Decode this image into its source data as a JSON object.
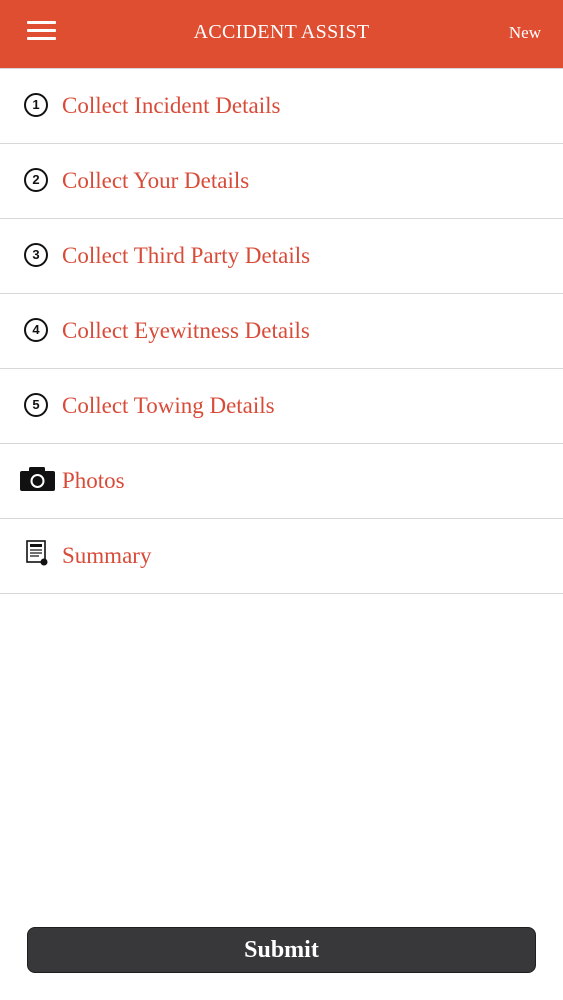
{
  "header": {
    "title": "ACCIDENT ASSIST",
    "action_label": "New",
    "menu_icon": "hamburger-menu-icon",
    "background_color": "#e04e32"
  },
  "list": {
    "items": [
      {
        "icon": "number-1-icon",
        "badge": "1",
        "label": "Collect Incident Details"
      },
      {
        "icon": "number-2-icon",
        "badge": "2",
        "label": "Collect Your Details"
      },
      {
        "icon": "number-3-icon",
        "badge": "3",
        "label": "Collect Third Party Details"
      },
      {
        "icon": "number-4-icon",
        "badge": "4",
        "label": "Collect Eyewitness Details"
      },
      {
        "icon": "number-5-icon",
        "badge": "5",
        "label": "Collect Towing Details"
      },
      {
        "icon": "camera-icon",
        "label": "Photos"
      },
      {
        "icon": "document-icon",
        "label": "Summary"
      }
    ],
    "label_color": "#d84b38"
  },
  "footer": {
    "submit_label": "Submit",
    "button_color": "#38373a"
  }
}
